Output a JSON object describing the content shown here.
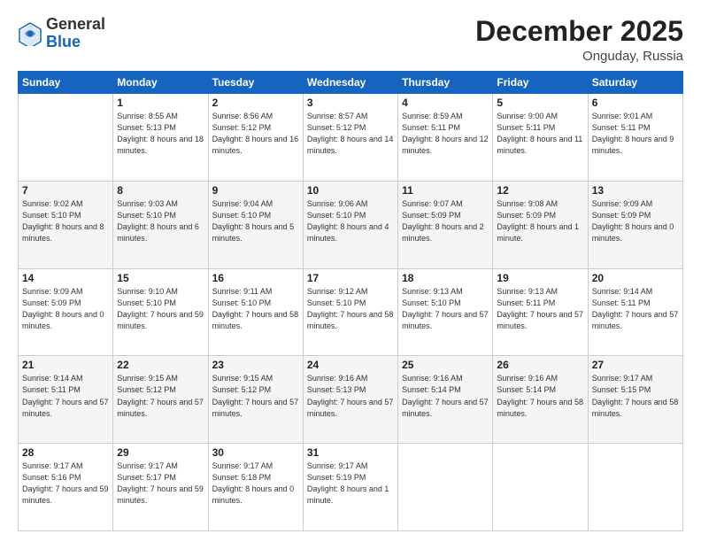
{
  "header": {
    "logo": {
      "general": "General",
      "blue": "Blue"
    },
    "month": "December 2025",
    "location": "Onguday, Russia"
  },
  "weekdays": [
    "Sunday",
    "Monday",
    "Tuesday",
    "Wednesday",
    "Thursday",
    "Friday",
    "Saturday"
  ],
  "weeks": [
    [
      {
        "day": "",
        "sunrise": "",
        "sunset": "",
        "daylight": ""
      },
      {
        "day": "1",
        "sunrise": "Sunrise: 8:55 AM",
        "sunset": "Sunset: 5:13 PM",
        "daylight": "Daylight: 8 hours and 18 minutes."
      },
      {
        "day": "2",
        "sunrise": "Sunrise: 8:56 AM",
        "sunset": "Sunset: 5:12 PM",
        "daylight": "Daylight: 8 hours and 16 minutes."
      },
      {
        "day": "3",
        "sunrise": "Sunrise: 8:57 AM",
        "sunset": "Sunset: 5:12 PM",
        "daylight": "Daylight: 8 hours and 14 minutes."
      },
      {
        "day": "4",
        "sunrise": "Sunrise: 8:59 AM",
        "sunset": "Sunset: 5:11 PM",
        "daylight": "Daylight: 8 hours and 12 minutes."
      },
      {
        "day": "5",
        "sunrise": "Sunrise: 9:00 AM",
        "sunset": "Sunset: 5:11 PM",
        "daylight": "Daylight: 8 hours and 11 minutes."
      },
      {
        "day": "6",
        "sunrise": "Sunrise: 9:01 AM",
        "sunset": "Sunset: 5:11 PM",
        "daylight": "Daylight: 8 hours and 9 minutes."
      }
    ],
    [
      {
        "day": "7",
        "sunrise": "Sunrise: 9:02 AM",
        "sunset": "Sunset: 5:10 PM",
        "daylight": "Daylight: 8 hours and 8 minutes."
      },
      {
        "day": "8",
        "sunrise": "Sunrise: 9:03 AM",
        "sunset": "Sunset: 5:10 PM",
        "daylight": "Daylight: 8 hours and 6 minutes."
      },
      {
        "day": "9",
        "sunrise": "Sunrise: 9:04 AM",
        "sunset": "Sunset: 5:10 PM",
        "daylight": "Daylight: 8 hours and 5 minutes."
      },
      {
        "day": "10",
        "sunrise": "Sunrise: 9:06 AM",
        "sunset": "Sunset: 5:10 PM",
        "daylight": "Daylight: 8 hours and 4 minutes."
      },
      {
        "day": "11",
        "sunrise": "Sunrise: 9:07 AM",
        "sunset": "Sunset: 5:09 PM",
        "daylight": "Daylight: 8 hours and 2 minutes."
      },
      {
        "day": "12",
        "sunrise": "Sunrise: 9:08 AM",
        "sunset": "Sunset: 5:09 PM",
        "daylight": "Daylight: 8 hours and 1 minute."
      },
      {
        "day": "13",
        "sunrise": "Sunrise: 9:09 AM",
        "sunset": "Sunset: 5:09 PM",
        "daylight": "Daylight: 8 hours and 0 minutes."
      }
    ],
    [
      {
        "day": "14",
        "sunrise": "Sunrise: 9:09 AM",
        "sunset": "Sunset: 5:09 PM",
        "daylight": "Daylight: 8 hours and 0 minutes."
      },
      {
        "day": "15",
        "sunrise": "Sunrise: 9:10 AM",
        "sunset": "Sunset: 5:10 PM",
        "daylight": "Daylight: 7 hours and 59 minutes."
      },
      {
        "day": "16",
        "sunrise": "Sunrise: 9:11 AM",
        "sunset": "Sunset: 5:10 PM",
        "daylight": "Daylight: 7 hours and 58 minutes."
      },
      {
        "day": "17",
        "sunrise": "Sunrise: 9:12 AM",
        "sunset": "Sunset: 5:10 PM",
        "daylight": "Daylight: 7 hours and 58 minutes."
      },
      {
        "day": "18",
        "sunrise": "Sunrise: 9:13 AM",
        "sunset": "Sunset: 5:10 PM",
        "daylight": "Daylight: 7 hours and 57 minutes."
      },
      {
        "day": "19",
        "sunrise": "Sunrise: 9:13 AM",
        "sunset": "Sunset: 5:11 PM",
        "daylight": "Daylight: 7 hours and 57 minutes."
      },
      {
        "day": "20",
        "sunrise": "Sunrise: 9:14 AM",
        "sunset": "Sunset: 5:11 PM",
        "daylight": "Daylight: 7 hours and 57 minutes."
      }
    ],
    [
      {
        "day": "21",
        "sunrise": "Sunrise: 9:14 AM",
        "sunset": "Sunset: 5:11 PM",
        "daylight": "Daylight: 7 hours and 57 minutes."
      },
      {
        "day": "22",
        "sunrise": "Sunrise: 9:15 AM",
        "sunset": "Sunset: 5:12 PM",
        "daylight": "Daylight: 7 hours and 57 minutes."
      },
      {
        "day": "23",
        "sunrise": "Sunrise: 9:15 AM",
        "sunset": "Sunset: 5:12 PM",
        "daylight": "Daylight: 7 hours and 57 minutes."
      },
      {
        "day": "24",
        "sunrise": "Sunrise: 9:16 AM",
        "sunset": "Sunset: 5:13 PM",
        "daylight": "Daylight: 7 hours and 57 minutes."
      },
      {
        "day": "25",
        "sunrise": "Sunrise: 9:16 AM",
        "sunset": "Sunset: 5:14 PM",
        "daylight": "Daylight: 7 hours and 57 minutes."
      },
      {
        "day": "26",
        "sunrise": "Sunrise: 9:16 AM",
        "sunset": "Sunset: 5:14 PM",
        "daylight": "Daylight: 7 hours and 58 minutes."
      },
      {
        "day": "27",
        "sunrise": "Sunrise: 9:17 AM",
        "sunset": "Sunset: 5:15 PM",
        "daylight": "Daylight: 7 hours and 58 minutes."
      }
    ],
    [
      {
        "day": "28",
        "sunrise": "Sunrise: 9:17 AM",
        "sunset": "Sunset: 5:16 PM",
        "daylight": "Daylight: 7 hours and 59 minutes."
      },
      {
        "day": "29",
        "sunrise": "Sunrise: 9:17 AM",
        "sunset": "Sunset: 5:17 PM",
        "daylight": "Daylight: 7 hours and 59 minutes."
      },
      {
        "day": "30",
        "sunrise": "Sunrise: 9:17 AM",
        "sunset": "Sunset: 5:18 PM",
        "daylight": "Daylight: 8 hours and 0 minutes."
      },
      {
        "day": "31",
        "sunrise": "Sunrise: 9:17 AM",
        "sunset": "Sunset: 5:19 PM",
        "daylight": "Daylight: 8 hours and 1 minute."
      },
      {
        "day": "",
        "sunrise": "",
        "sunset": "",
        "daylight": ""
      },
      {
        "day": "",
        "sunrise": "",
        "sunset": "",
        "daylight": ""
      },
      {
        "day": "",
        "sunrise": "",
        "sunset": "",
        "daylight": ""
      }
    ]
  ]
}
